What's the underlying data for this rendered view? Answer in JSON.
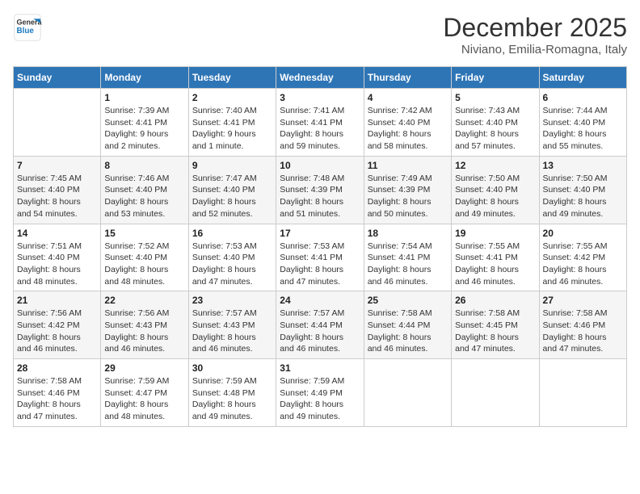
{
  "logo": {
    "line1": "General",
    "line2": "Blue"
  },
  "header": {
    "month": "December 2025",
    "location": "Niviano, Emilia-Romagna, Italy"
  },
  "days_of_week": [
    "Sunday",
    "Monday",
    "Tuesday",
    "Wednesday",
    "Thursday",
    "Friday",
    "Saturday"
  ],
  "weeks": [
    [
      {
        "day": "",
        "info": ""
      },
      {
        "day": "1",
        "info": "Sunrise: 7:39 AM\nSunset: 4:41 PM\nDaylight: 9 hours\nand 2 minutes."
      },
      {
        "day": "2",
        "info": "Sunrise: 7:40 AM\nSunset: 4:41 PM\nDaylight: 9 hours\nand 1 minute."
      },
      {
        "day": "3",
        "info": "Sunrise: 7:41 AM\nSunset: 4:41 PM\nDaylight: 8 hours\nand 59 minutes."
      },
      {
        "day": "4",
        "info": "Sunrise: 7:42 AM\nSunset: 4:40 PM\nDaylight: 8 hours\nand 58 minutes."
      },
      {
        "day": "5",
        "info": "Sunrise: 7:43 AM\nSunset: 4:40 PM\nDaylight: 8 hours\nand 57 minutes."
      },
      {
        "day": "6",
        "info": "Sunrise: 7:44 AM\nSunset: 4:40 PM\nDaylight: 8 hours\nand 55 minutes."
      }
    ],
    [
      {
        "day": "7",
        "info": "Sunrise: 7:45 AM\nSunset: 4:40 PM\nDaylight: 8 hours\nand 54 minutes."
      },
      {
        "day": "8",
        "info": "Sunrise: 7:46 AM\nSunset: 4:40 PM\nDaylight: 8 hours\nand 53 minutes."
      },
      {
        "day": "9",
        "info": "Sunrise: 7:47 AM\nSunset: 4:40 PM\nDaylight: 8 hours\nand 52 minutes."
      },
      {
        "day": "10",
        "info": "Sunrise: 7:48 AM\nSunset: 4:39 PM\nDaylight: 8 hours\nand 51 minutes."
      },
      {
        "day": "11",
        "info": "Sunrise: 7:49 AM\nSunset: 4:39 PM\nDaylight: 8 hours\nand 50 minutes."
      },
      {
        "day": "12",
        "info": "Sunrise: 7:50 AM\nSunset: 4:40 PM\nDaylight: 8 hours\nand 49 minutes."
      },
      {
        "day": "13",
        "info": "Sunrise: 7:50 AM\nSunset: 4:40 PM\nDaylight: 8 hours\nand 49 minutes."
      }
    ],
    [
      {
        "day": "14",
        "info": "Sunrise: 7:51 AM\nSunset: 4:40 PM\nDaylight: 8 hours\nand 48 minutes."
      },
      {
        "day": "15",
        "info": "Sunrise: 7:52 AM\nSunset: 4:40 PM\nDaylight: 8 hours\nand 48 minutes."
      },
      {
        "day": "16",
        "info": "Sunrise: 7:53 AM\nSunset: 4:40 PM\nDaylight: 8 hours\nand 47 minutes."
      },
      {
        "day": "17",
        "info": "Sunrise: 7:53 AM\nSunset: 4:41 PM\nDaylight: 8 hours\nand 47 minutes."
      },
      {
        "day": "18",
        "info": "Sunrise: 7:54 AM\nSunset: 4:41 PM\nDaylight: 8 hours\nand 46 minutes."
      },
      {
        "day": "19",
        "info": "Sunrise: 7:55 AM\nSunset: 4:41 PM\nDaylight: 8 hours\nand 46 minutes."
      },
      {
        "day": "20",
        "info": "Sunrise: 7:55 AM\nSunset: 4:42 PM\nDaylight: 8 hours\nand 46 minutes."
      }
    ],
    [
      {
        "day": "21",
        "info": "Sunrise: 7:56 AM\nSunset: 4:42 PM\nDaylight: 8 hours\nand 46 minutes."
      },
      {
        "day": "22",
        "info": "Sunrise: 7:56 AM\nSunset: 4:43 PM\nDaylight: 8 hours\nand 46 minutes."
      },
      {
        "day": "23",
        "info": "Sunrise: 7:57 AM\nSunset: 4:43 PM\nDaylight: 8 hours\nand 46 minutes."
      },
      {
        "day": "24",
        "info": "Sunrise: 7:57 AM\nSunset: 4:44 PM\nDaylight: 8 hours\nand 46 minutes."
      },
      {
        "day": "25",
        "info": "Sunrise: 7:58 AM\nSunset: 4:44 PM\nDaylight: 8 hours\nand 46 minutes."
      },
      {
        "day": "26",
        "info": "Sunrise: 7:58 AM\nSunset: 4:45 PM\nDaylight: 8 hours\nand 47 minutes."
      },
      {
        "day": "27",
        "info": "Sunrise: 7:58 AM\nSunset: 4:46 PM\nDaylight: 8 hours\nand 47 minutes."
      }
    ],
    [
      {
        "day": "28",
        "info": "Sunrise: 7:58 AM\nSunset: 4:46 PM\nDaylight: 8 hours\nand 47 minutes."
      },
      {
        "day": "29",
        "info": "Sunrise: 7:59 AM\nSunset: 4:47 PM\nDaylight: 8 hours\nand 48 minutes."
      },
      {
        "day": "30",
        "info": "Sunrise: 7:59 AM\nSunset: 4:48 PM\nDaylight: 8 hours\nand 49 minutes."
      },
      {
        "day": "31",
        "info": "Sunrise: 7:59 AM\nSunset: 4:49 PM\nDaylight: 8 hours\nand 49 minutes."
      },
      {
        "day": "",
        "info": ""
      },
      {
        "day": "",
        "info": ""
      },
      {
        "day": "",
        "info": ""
      }
    ]
  ]
}
